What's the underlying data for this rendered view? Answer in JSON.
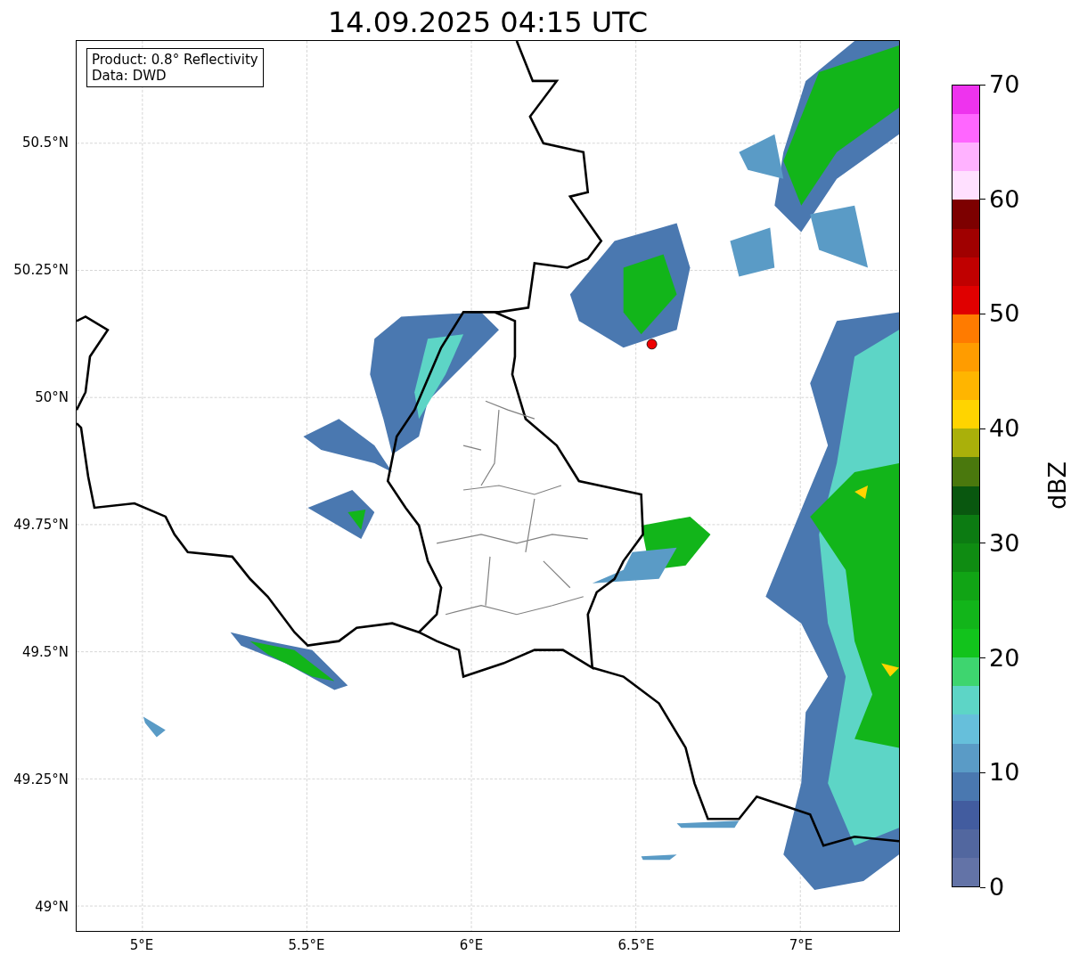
{
  "title": "14.09.2025 04:15 UTC",
  "info_box": [
    "Product: 0.8° Reflectivity",
    "Data: DWD"
  ],
  "map": {
    "x_tick_labels": [
      "5°E",
      "5.5°E",
      "6°E",
      "6.5°E",
      "7°E"
    ],
    "y_tick_labels": [
      "50.5°N",
      "50.25°N",
      "50°N",
      "49.75°N",
      "49.5°N",
      "49.25°N",
      "49°N"
    ]
  },
  "colorbar": {
    "label": "dBZ",
    "tick_labels": [
      "70",
      "60",
      "50",
      "40",
      "30",
      "20",
      "10",
      "0"
    ]
  }
}
